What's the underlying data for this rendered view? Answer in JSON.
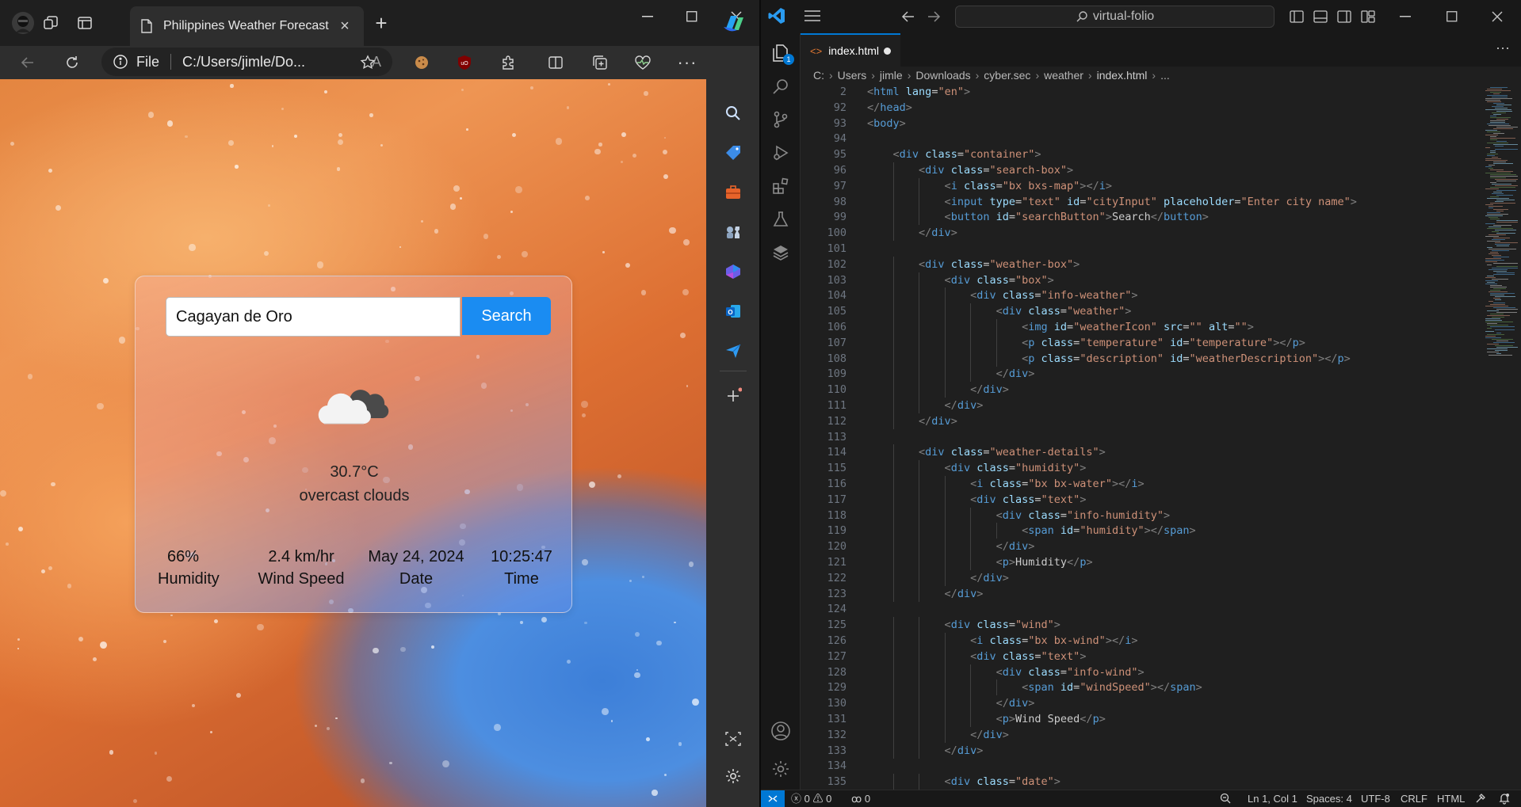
{
  "browser": {
    "tab_title": "Philippines Weather Forecast",
    "address_prefix": "File",
    "address_url": "C:/Users/jimle/Do...",
    "new_tab_label": "+"
  },
  "weather_app": {
    "city_value": "Cagayan de Oro",
    "city_placeholder": "Enter city name",
    "search_label": "Search",
    "temperature": "30.7°C",
    "description": "overcast clouds",
    "humidity_value": "66%",
    "humidity_label": "Humidity",
    "wind_value": "2.4 km/hr",
    "wind_label": "Wind Speed",
    "date_value": "May 24, 2024",
    "date_label": "Date",
    "time_value": "10:25:47",
    "time_label": "Time",
    "icon": "overcast-clouds-icon"
  },
  "vscode": {
    "search_text": "virtual-folio",
    "tab_name": "index.html",
    "activity_badge": "1",
    "breadcrumb": [
      "C:",
      "Users",
      "jimle",
      "Downloads",
      "cyber.sec",
      "weather",
      "index.html",
      "..."
    ],
    "status": {
      "errors": "0",
      "warnings": "0",
      "ports": "0",
      "position": "Ln 1, Col 1",
      "spaces": "Spaces: 4",
      "encoding": "UTF-8",
      "eol": "CRLF",
      "language": "HTML"
    },
    "lines": [
      {
        "n": "2",
        "i": 0,
        "t": "<html lang=\"en\">"
      },
      {
        "n": "92",
        "i": 0,
        "t": "</head>"
      },
      {
        "n": "93",
        "i": 0,
        "t": "<body>"
      },
      {
        "n": "94",
        "i": 0,
        "t": ""
      },
      {
        "n": "95",
        "i": 1,
        "t": "<div class=\"container\">"
      },
      {
        "n": "96",
        "i": 2,
        "t": "<div class=\"search-box\">"
      },
      {
        "n": "97",
        "i": 3,
        "t": "<i class=\"bx bxs-map\"></i>"
      },
      {
        "n": "98",
        "i": 3,
        "t": "<input type=\"text\" id=\"cityInput\" placeholder=\"Enter city name\">"
      },
      {
        "n": "99",
        "i": 3,
        "t": "<button id=\"searchButton\">Search</button>"
      },
      {
        "n": "100",
        "i": 2,
        "t": "</div>"
      },
      {
        "n": "101",
        "i": 0,
        "t": ""
      },
      {
        "n": "102",
        "i": 2,
        "t": "<div class=\"weather-box\">"
      },
      {
        "n": "103",
        "i": 3,
        "t": "<div class=\"box\">"
      },
      {
        "n": "104",
        "i": 4,
        "t": "<div class=\"info-weather\">"
      },
      {
        "n": "105",
        "i": 5,
        "t": "<div class=\"weather\">"
      },
      {
        "n": "106",
        "i": 6,
        "t": "<img id=\"weatherIcon\" src=\"\" alt=\"\">"
      },
      {
        "n": "107",
        "i": 6,
        "t": "<p class=\"temperature\" id=\"temperature\"></p>"
      },
      {
        "n": "108",
        "i": 6,
        "t": "<p class=\"description\" id=\"weatherDescription\"></p>"
      },
      {
        "n": "109",
        "i": 5,
        "t": "</div>"
      },
      {
        "n": "110",
        "i": 4,
        "t": "</div>"
      },
      {
        "n": "111",
        "i": 3,
        "t": "</div>"
      },
      {
        "n": "112",
        "i": 2,
        "t": "</div>"
      },
      {
        "n": "113",
        "i": 0,
        "t": ""
      },
      {
        "n": "114",
        "i": 2,
        "t": "<div class=\"weather-details\">"
      },
      {
        "n": "115",
        "i": 3,
        "t": "<div class=\"humidity\">"
      },
      {
        "n": "116",
        "i": 4,
        "t": "<i class=\"bx bx-water\"></i>"
      },
      {
        "n": "117",
        "i": 4,
        "t": "<div class=\"text\">"
      },
      {
        "n": "118",
        "i": 5,
        "t": "<div class=\"info-humidity\">"
      },
      {
        "n": "119",
        "i": 6,
        "t": "<span id=\"humidity\"></span>"
      },
      {
        "n": "120",
        "i": 5,
        "t": "</div>"
      },
      {
        "n": "121",
        "i": 5,
        "t": "<p>Humidity</p>"
      },
      {
        "n": "122",
        "i": 4,
        "t": "</div>"
      },
      {
        "n": "123",
        "i": 3,
        "t": "</div>"
      },
      {
        "n": "124",
        "i": 0,
        "t": ""
      },
      {
        "n": "125",
        "i": 3,
        "t": "<div class=\"wind\">"
      },
      {
        "n": "126",
        "i": 4,
        "t": "<i class=\"bx bx-wind\"></i>"
      },
      {
        "n": "127",
        "i": 4,
        "t": "<div class=\"text\">"
      },
      {
        "n": "128",
        "i": 5,
        "t": "<div class=\"info-wind\">"
      },
      {
        "n": "129",
        "i": 6,
        "t": "<span id=\"windSpeed\"></span>"
      },
      {
        "n": "130",
        "i": 5,
        "t": "</div>"
      },
      {
        "n": "131",
        "i": 5,
        "t": "<p>Wind Speed</p>"
      },
      {
        "n": "132",
        "i": 4,
        "t": "</div>"
      },
      {
        "n": "133",
        "i": 3,
        "t": "</div>"
      },
      {
        "n": "134",
        "i": 0,
        "t": ""
      },
      {
        "n": "135",
        "i": 3,
        "t": "<div class=\"date\">"
      }
    ]
  },
  "colors": {
    "search_button": "#1a8cf2",
    "vscode_accent": "#0078d4",
    "tag": "#569cd6",
    "attr_name": "#9cdcfe",
    "attr_value": "#ce9178",
    "bracket": "#808080"
  }
}
